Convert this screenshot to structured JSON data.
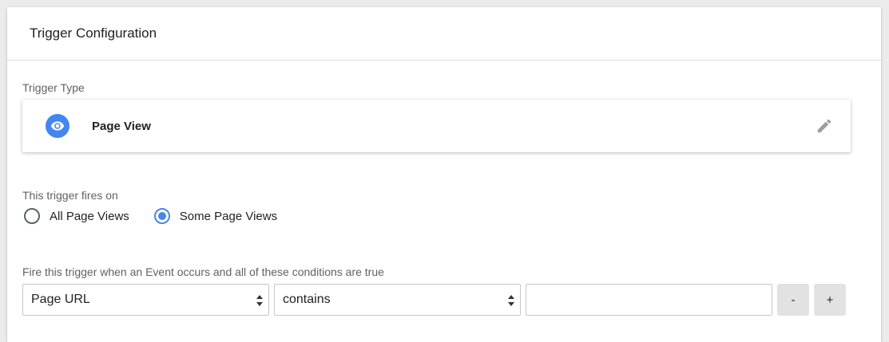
{
  "panel": {
    "title": "Trigger Configuration"
  },
  "trigger_type": {
    "label": "Trigger Type",
    "name": "Page View",
    "icon": "eye-icon",
    "icon_color": "#4285f4",
    "edit_icon": "pencil-icon"
  },
  "fires_on": {
    "label": "This trigger fires on",
    "options": [
      {
        "label": "All Page Views",
        "checked": false
      },
      {
        "label": "Some Page Views",
        "checked": true
      }
    ],
    "accent_color": "#4a86e8"
  },
  "conditions": {
    "label": "Fire this trigger when an Event occurs and all of these conditions are true",
    "variable": "Page URL",
    "operator": "contains",
    "value": "",
    "remove_label": "-",
    "add_label": "+"
  }
}
